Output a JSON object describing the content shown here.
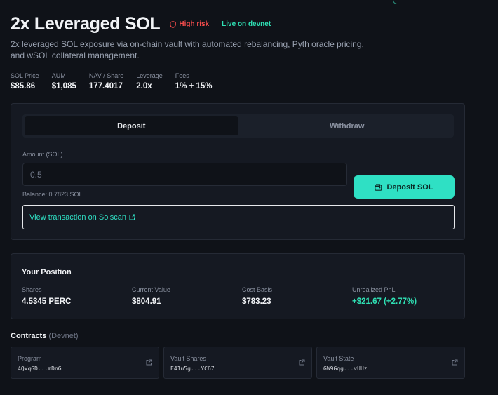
{
  "title": "2x Leveraged SOL",
  "badges": {
    "risk": "High risk",
    "network": "Live on devnet"
  },
  "description": "2x leveraged SOL exposure via on-chain vault with automated rebalancing, Pyth oracle pricing, and wSOL collateral management.",
  "stats": [
    {
      "label": "SOL Price",
      "value": "$85.86"
    },
    {
      "label": "AUM",
      "value": "$1,085"
    },
    {
      "label": "NAV / Share",
      "value": "177.4017"
    },
    {
      "label": "Leverage",
      "value": "2.0x"
    },
    {
      "label": "Fees",
      "value": "1% + 15%"
    }
  ],
  "tabs": {
    "deposit": "Deposit",
    "withdraw": "Withdraw"
  },
  "form": {
    "amount_label": "Amount (SOL)",
    "amount_placeholder": "0.5",
    "amount_value": "",
    "balance": "Balance: 0.7823 SOL",
    "submit_label": "Deposit SOL",
    "tx_link": "View transaction on Solscan"
  },
  "position": {
    "title": "Your Position",
    "items": [
      {
        "label": "Shares",
        "value": "4.5345 PERC"
      },
      {
        "label": "Current Value",
        "value": "$804.91"
      },
      {
        "label": "Cost Basis",
        "value": "$783.23"
      },
      {
        "label": "Unrealized PnL",
        "value": "+$21.67 (+2.77%)"
      }
    ]
  },
  "contracts": {
    "title": "Contracts",
    "network": "(Devnet)",
    "items": [
      {
        "label": "Program",
        "address": "4QVqGD...mDnG",
        "icon": "external-link-icon"
      },
      {
        "label": "Vault Shares",
        "address": "E41u5g...YC67",
        "icon": "external-link-icon"
      },
      {
        "label": "Vault State",
        "address": "GW9Gqg...vUUz",
        "icon": "external-link-icon"
      }
    ]
  },
  "colors": {
    "accent": "#2fe0c4",
    "danger": "#f24b4b",
    "success": "#2fe0b4",
    "background": "#0f1218",
    "card": "#151922"
  }
}
